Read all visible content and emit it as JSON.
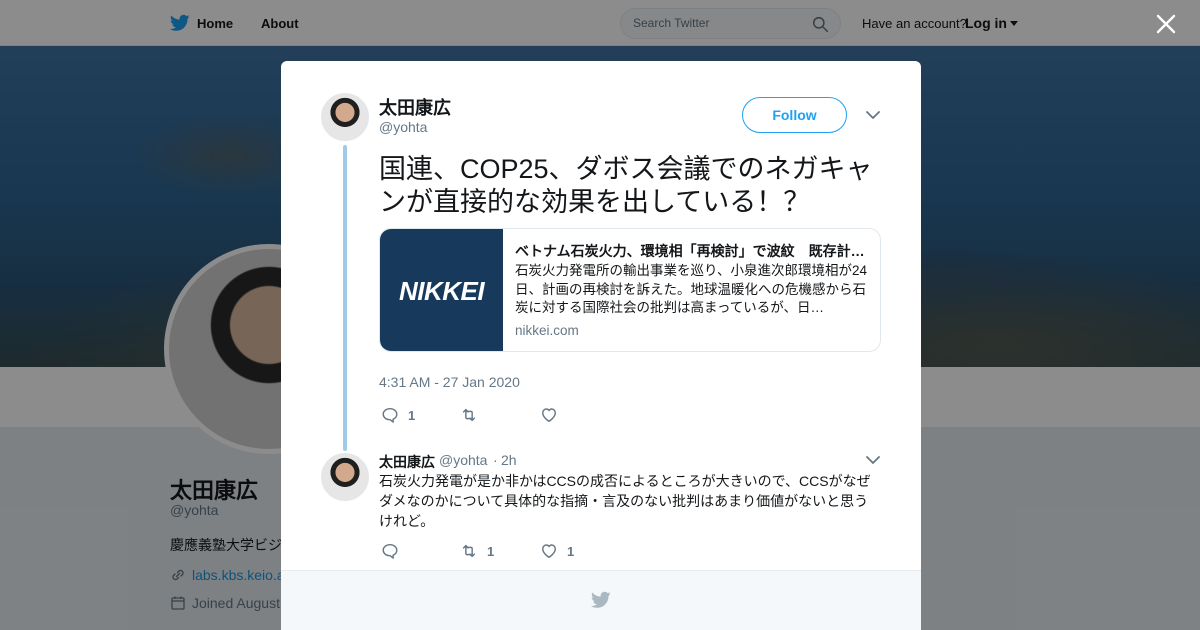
{
  "nav": {
    "home_label": "Home",
    "about_label": "About",
    "search_placeholder": "Search Twitter",
    "have_account": "Have an account?",
    "login_label": "Log in"
  },
  "profile": {
    "name": "太田康広",
    "handle": "@yohta",
    "bio": "慶應義塾大学ビジ",
    "url": "labs.kbs.keio.a",
    "joined": "Joined August"
  },
  "tweet": {
    "author_name": "太田康広",
    "author_handle": "@yohta",
    "follow_label": "Follow",
    "text": "国連、COP25、ダボス会議でのネガキャンが直接的な効果を出している！？",
    "card": {
      "title": "ベトナム石炭火力、環境相「再検討」で波紋　既存計…",
      "description": "石炭火力発電所の輸出事業を巡り、小泉進次郎環境相が24日、計画の再検討を訴えた。地球温暖化への危機感から石炭に対する国際社会の批判は高まっているが、日…",
      "domain": "nikkei.com",
      "logo_text": "NIKKEI"
    },
    "timestamp": "4:31 AM - 27 Jan 2020",
    "reply_count": "1",
    "retweet_count": "",
    "like_count": ""
  },
  "reply": {
    "author_name": "太田康広",
    "author_handle": "@yohta",
    "separator": "·",
    "time": "2h",
    "text": "石炭火力発電が是か非かはCCSの成否によるところが大きいので、CCSがなぜダメなのかについて具体的な指摘・言及のない批判はあまり価値がないと思うけれど。",
    "reply_count": "",
    "retweet_count": "1",
    "like_count": "1"
  },
  "colors": {
    "brand": "#1da1f2",
    "thread_line": "#9fcbe8",
    "muted_text": "#657786"
  }
}
